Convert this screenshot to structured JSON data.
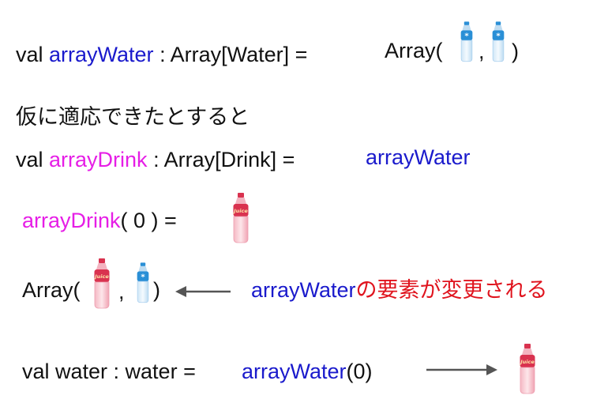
{
  "colors": {
    "text": "#111111",
    "blue": "#1a1acc",
    "magenta": "#e61ee6",
    "red": "#e0141e"
  },
  "icons": {
    "water": "water-bottle-icon",
    "juice": "juice-bottle-icon"
  },
  "line1": {
    "prefix": "val ",
    "var": "arrayWater",
    "type": " : Array[Water] =",
    "rhs_open": "Array(",
    "comma": ",",
    "rhs_close": ")"
  },
  "line2": {
    "text": "仮に適応できたとすると"
  },
  "line3": {
    "prefix": "val ",
    "var": "arrayDrink",
    "type": " : Array[Drink] =",
    "rhs": "arrayWater"
  },
  "line4": {
    "var": "arrayDrink",
    "rest": "( 0 ) ="
  },
  "line5": {
    "open": "Array(",
    "comma": ",",
    "close": ")",
    "ref": "arrayWater",
    "note": "の要素が変更される"
  },
  "line6": {
    "prefix": "val water : water =",
    "ref": "arrayWater",
    "arg": "(0)"
  }
}
